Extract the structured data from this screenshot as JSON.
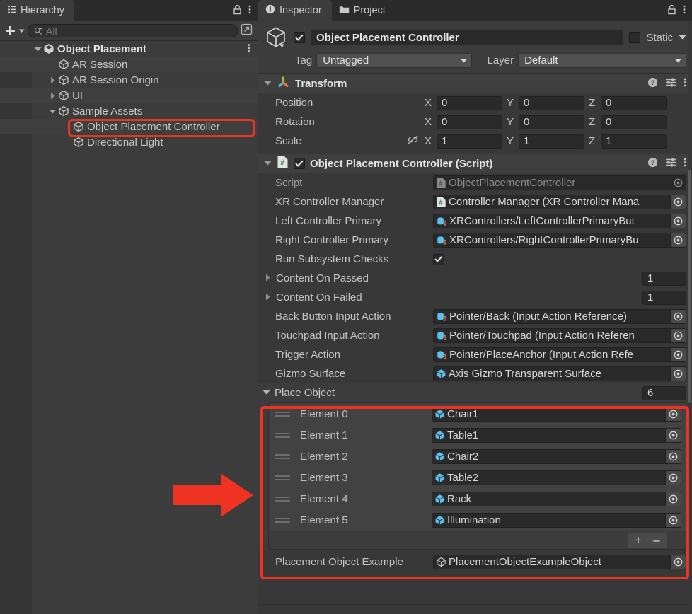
{
  "hierarchy": {
    "tab_label": "Hierarchy",
    "tab_icon": "hierarchy-icon",
    "lock_icon": "lock-icon",
    "menu_icon": "kebab-menu-icon",
    "toolbar": {
      "add_label": "+",
      "search_placeholder": "All",
      "search_value": "",
      "search_icon": "search-icon",
      "picker_icon": "window-picker-icon"
    },
    "rows": [
      {
        "label": "Object Placement",
        "indent": 0,
        "foldout": "down",
        "icon": "unity-scene-icon",
        "bold": true,
        "alt": false,
        "selected": false,
        "menu": true
      },
      {
        "label": "AR Session",
        "indent": 1,
        "foldout": "none",
        "icon": "gameobject-cube-icon",
        "bold": false,
        "alt": true,
        "selected": false,
        "menu": false
      },
      {
        "label": "AR Session Origin",
        "indent": 1,
        "foldout": "right",
        "icon": "gameobject-cube-icon",
        "bold": false,
        "alt": false,
        "selected": false,
        "menu": false
      },
      {
        "label": "UI",
        "indent": 1,
        "foldout": "right",
        "icon": "gameobject-cube-icon",
        "bold": false,
        "alt": true,
        "selected": false,
        "menu": false
      },
      {
        "label": "Sample Assets",
        "indent": 1,
        "foldout": "down",
        "icon": "gameobject-cube-icon",
        "bold": false,
        "alt": false,
        "selected": false,
        "menu": false
      },
      {
        "label": "Object Placement Controller",
        "indent": 2,
        "foldout": "none",
        "icon": "gameobject-cube-icon",
        "bold": false,
        "alt": true,
        "selected": true,
        "menu": false
      },
      {
        "label": "Directional Light",
        "indent": 2,
        "foldout": "none",
        "icon": "gameobject-cube-icon",
        "bold": false,
        "alt": false,
        "selected": false,
        "menu": false
      }
    ]
  },
  "inspector": {
    "tabs": [
      {
        "label": "Inspector",
        "icon": "info-icon",
        "active": true
      },
      {
        "label": "Project",
        "icon": "folder-icon",
        "active": false
      }
    ],
    "lock_icon": "lock-icon",
    "menu_icon": "kebab-menu-icon",
    "object_header": {
      "prefab_icon": "gameobject-cube-icon",
      "enabled_checkbox": true,
      "name": "Object Placement Controller",
      "static_checkbox": false,
      "static_label": "Static",
      "static_dropdown_icon": "chevron-down-icon",
      "tag_label": "Tag",
      "tag_value": "Untagged",
      "layer_label": "Layer",
      "layer_value": "Default"
    },
    "transform": {
      "title": "Transform",
      "icon": "transform-gizmo-icon",
      "help_icon": "help-icon",
      "preset_icon": "preset-sliders-icon",
      "menu_icon": "kebab-menu-icon",
      "foldout": "down",
      "rows": [
        {
          "label": "Position",
          "link_icon": false,
          "x": "0",
          "y": "0",
          "z": "0"
        },
        {
          "label": "Rotation",
          "link_icon": false,
          "x": "0",
          "y": "0",
          "z": "0"
        },
        {
          "label": "Scale",
          "link_icon": true,
          "x": "1",
          "y": "1",
          "z": "1"
        }
      ],
      "axis_labels": [
        "X",
        "Y",
        "Z"
      ]
    },
    "script_component": {
      "title": "Object Placement Controller (Script)",
      "icon": "csharp-script-icon",
      "enabled_checkbox": true,
      "help_icon": "help-icon",
      "preset_icon": "preset-sliders-icon",
      "menu_icon": "kebab-menu-icon",
      "foldout": "down",
      "properties": [
        {
          "label": "Script",
          "type": "object",
          "icon": "csharp-script-icon",
          "value": "ObjectPlacementController",
          "disabled": true
        },
        {
          "label": "XR Controller Manager",
          "type": "object",
          "icon": "csharp-script-icon",
          "value": "Controller Manager (XR Controller Mana",
          "disabled": false
        },
        {
          "label": "Left Controller Primary",
          "type": "object",
          "icon": "input-action-icon",
          "value": "XRControllers/LeftControllerPrimaryBut",
          "disabled": false
        },
        {
          "label": "Right Controller Primary",
          "type": "object",
          "icon": "input-action-icon",
          "value": "XRControllers/RightControllerPrimaryBu",
          "disabled": false
        },
        {
          "label": "Run Subsystem Checks",
          "type": "bool",
          "value": true
        },
        {
          "label": "Content On Passed",
          "type": "array",
          "value": "1",
          "foldout": "right"
        },
        {
          "label": "Content On Failed",
          "type": "array",
          "value": "1",
          "foldout": "right"
        },
        {
          "label": "Back Button Input Action",
          "type": "object",
          "icon": "input-action-icon",
          "value": "Pointer/Back (Input Action Reference)",
          "disabled": false
        },
        {
          "label": "Touchpad Input Action",
          "type": "object",
          "icon": "input-action-icon",
          "value": "Pointer/Touchpad (Input Action Referen",
          "disabled": false
        },
        {
          "label": "Trigger Action",
          "type": "object",
          "icon": "input-action-icon",
          "value": "Pointer/PlaceAnchor (Input Action Refe",
          "disabled": false
        },
        {
          "label": "Gizmo Surface",
          "type": "object",
          "icon": "prefab-cube-icon",
          "value": "Axis Gizmo Transparent Surface",
          "disabled": false
        }
      ],
      "place_object_array": {
        "label": "Place Object",
        "foldout": "down",
        "size": "6",
        "elements": [
          {
            "label": "Element 0",
            "icon": "prefab-cube-icon",
            "value": "Chair1"
          },
          {
            "label": "Element 1",
            "icon": "prefab-cube-icon",
            "value": "Table1"
          },
          {
            "label": "Element 2",
            "icon": "prefab-cube-icon",
            "value": "Chair2"
          },
          {
            "label": "Element 3",
            "icon": "prefab-cube-icon",
            "value": "Table2"
          },
          {
            "label": "Element 4",
            "icon": "prefab-cube-icon",
            "value": "Rack"
          },
          {
            "label": "Element 5",
            "icon": "prefab-cube-icon",
            "value": "Illumination"
          }
        ],
        "add_label": "+",
        "remove_label": "–"
      },
      "last_property": {
        "label": "Placement Object Example",
        "icon": "gameobject-cube-icon",
        "value": "PlacementObjectExampleObject"
      }
    }
  },
  "annotations": {
    "highlight_color": "#ee3322",
    "arrow_icon": "right-arrow-annotation",
    "boxes": [
      "hierarchy-selected-row",
      "place-object-array"
    ]
  }
}
